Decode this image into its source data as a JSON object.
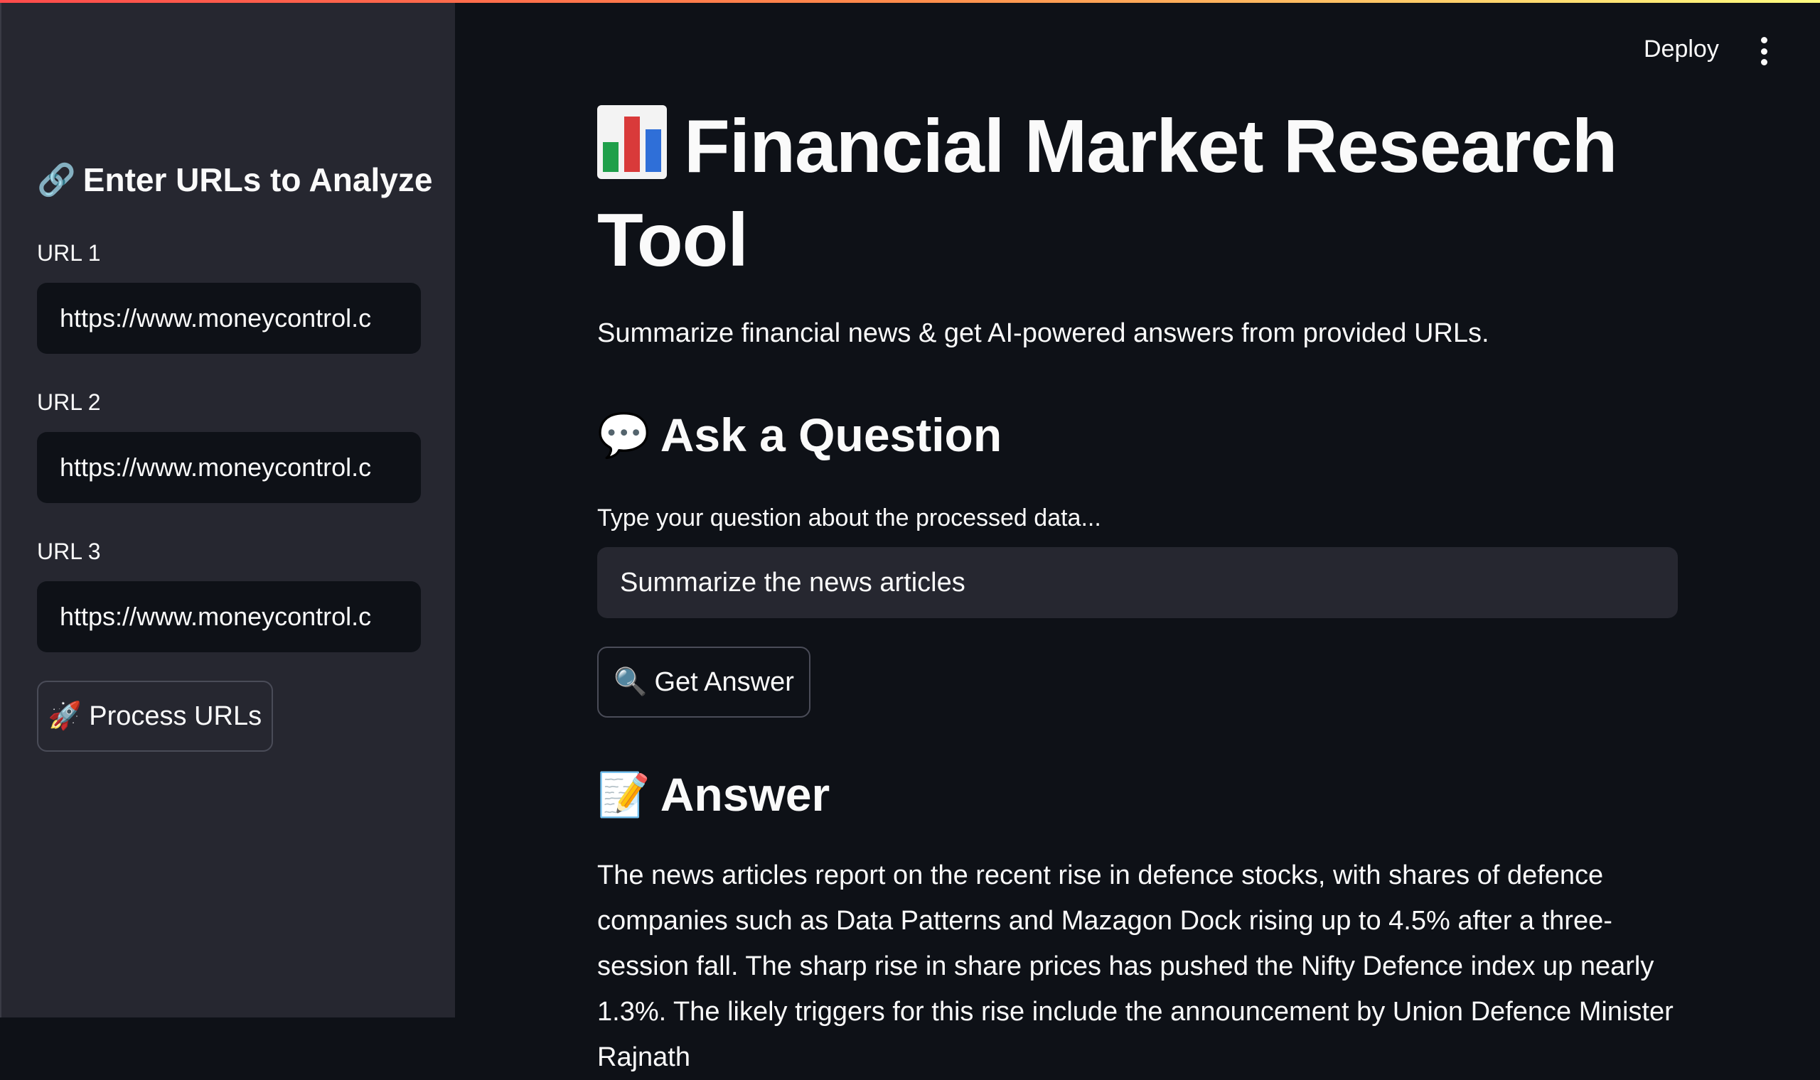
{
  "sidebar": {
    "header": {
      "emoji": "🔗",
      "text": "Enter URLs to Analyze"
    },
    "urls": [
      {
        "label": "URL 1",
        "value": "https://www.moneycontrol.c"
      },
      {
        "label": "URL 2",
        "value": "https://www.moneycontrol.c"
      },
      {
        "label": "URL 3",
        "value": "https://www.moneycontrol.c"
      }
    ],
    "process_button": {
      "emoji": "🚀",
      "label": "Process URLs"
    }
  },
  "toolbar": {
    "deploy_label": "Deploy"
  },
  "main": {
    "title": "Financial Market Research Tool",
    "subtitle": "Summarize financial news & get AI-powered answers from provided URLs.",
    "ask_section": {
      "emoji": "💬",
      "heading": "Ask a Question"
    },
    "question_label": "Type your question about the processed data...",
    "question_value": "Summarize the news articles",
    "answer_button": {
      "emoji": "🔍",
      "label": "Get Answer"
    },
    "answer_section": {
      "emoji": "📝",
      "heading": "Answer"
    },
    "answer_text": "The news articles report on the recent rise in defence stocks, with shares of defence companies such as Data Patterns and Mazagon Dock rising up to 4.5% after a three-session fall. The sharp rise in share prices has pushed the Nifty Defence index up nearly 1.3%. The likely triggers for this rise include the announcement by Union Defence Minister Rajnath"
  },
  "colors": {
    "app_background": "#0e1117",
    "sidebar_background": "#262730",
    "text": "#fafafa",
    "accent_stripe": [
      "#ff4b4b",
      "#fffd80"
    ]
  }
}
